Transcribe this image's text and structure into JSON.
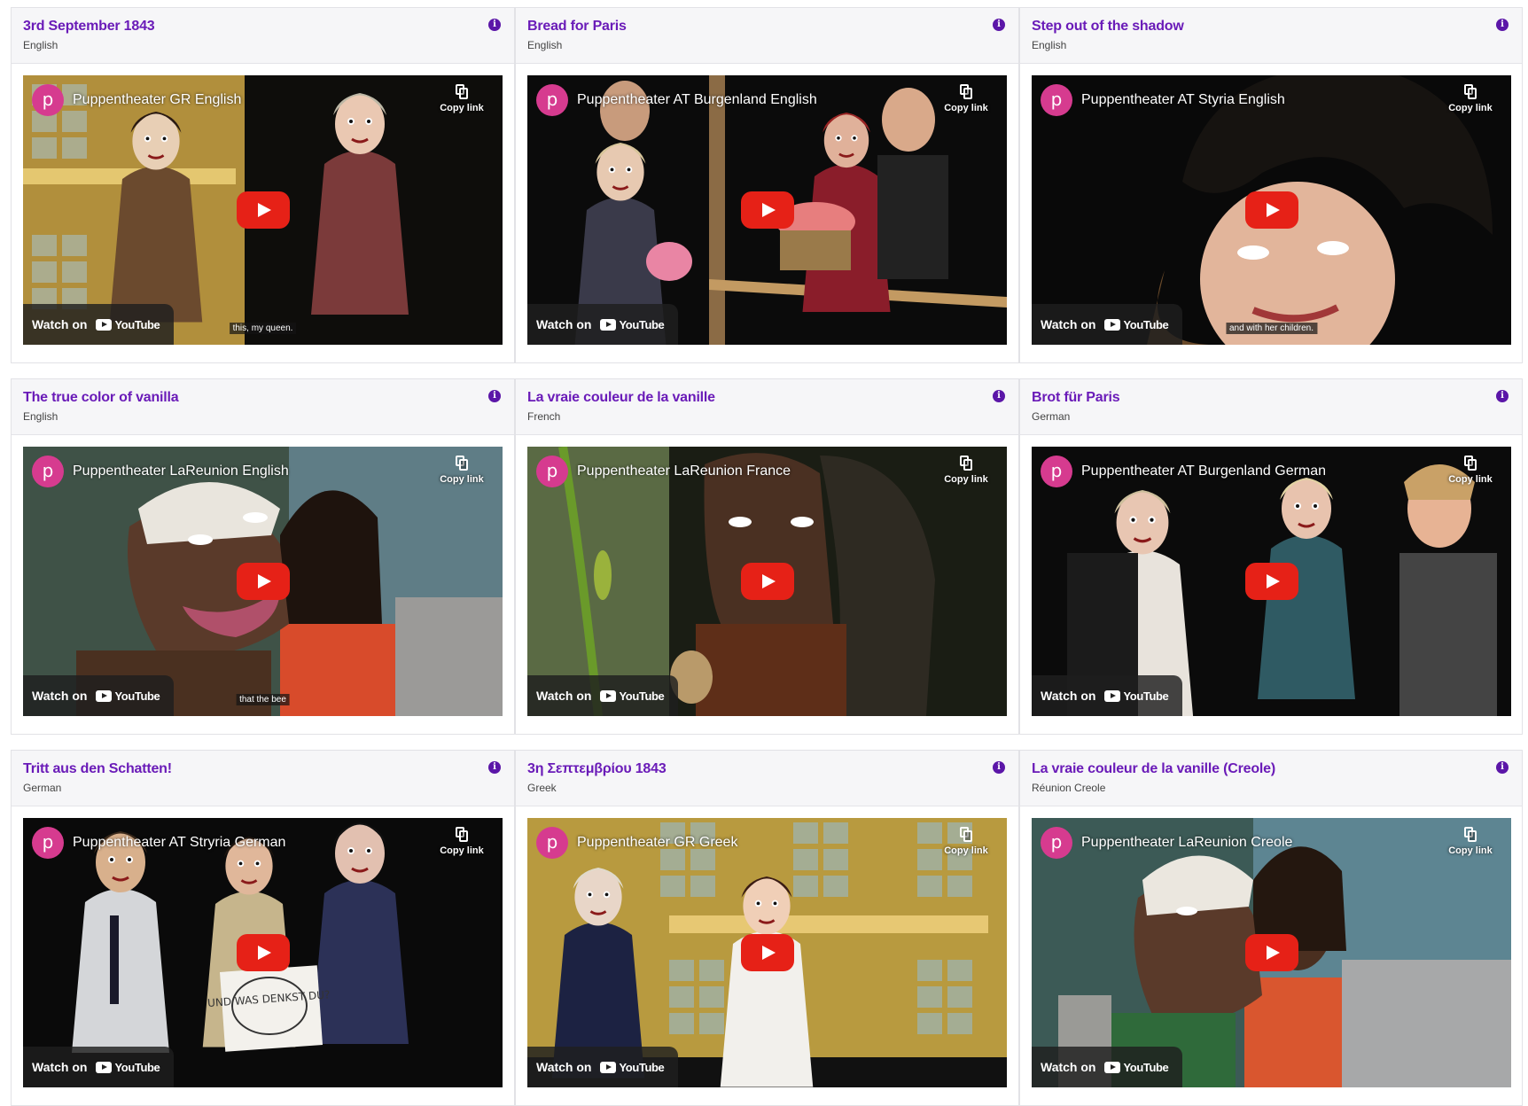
{
  "youtube": {
    "watch_on": "Watch on",
    "youtube_word": "YouTube",
    "copy_link": "Copy link",
    "avatar_letter": "p",
    "info_glyph": "i"
  },
  "cards": [
    {
      "title": "3rd September 1843",
      "language": "English",
      "channel": "Puppentheater GR English",
      "subtitle": "this, my queen.",
      "scene": "gr-street"
    },
    {
      "title": "Bread for Paris",
      "language": "English",
      "channel": "Puppentheater AT Burgenland English",
      "subtitle": "",
      "scene": "flower-stall"
    },
    {
      "title": "Step out of the shadow",
      "language": "English",
      "channel": "Puppentheater AT Styria English",
      "subtitle": "and with her children.",
      "scene": "closeup-curls"
    },
    {
      "title": "The true color of vanilla",
      "language": "English",
      "channel": "Puppentheater LaReunion English",
      "subtitle": "that the bee",
      "scene": "reunion-girl"
    },
    {
      "title": "La vraie couleur de la vanille",
      "language": "French",
      "channel": "Puppentheater LaReunion France",
      "subtitle": "",
      "scene": "reunion-dark"
    },
    {
      "title": "Brot für Paris",
      "language": "German",
      "channel": "Puppentheater AT Burgenland German",
      "subtitle": "",
      "scene": "burgenland-de"
    },
    {
      "title": "Tritt aus den Schatten!",
      "language": "German",
      "channel": "Puppentheater AT Stryria German",
      "subtitle": "",
      "scene": "three-puppets"
    },
    {
      "title": "3η Σεπτεμβρίου 1843",
      "language": "Greek",
      "channel": "Puppentheater GR Greek",
      "subtitle": "",
      "scene": "gr-street-2"
    },
    {
      "title": "La vraie couleur de la vanille (Creole)",
      "language": "Réunion Creole",
      "channel": "Puppentheater LaReunion Creole",
      "subtitle": "",
      "scene": "reunion-girl-2"
    }
  ],
  "sign_text": "UND WAS DENKST DU?",
  "colors": {
    "title": "#6a1bb8",
    "info_icon": "#5b16a8",
    "play_button": "#e62117",
    "avatar": "#d63b8f"
  }
}
